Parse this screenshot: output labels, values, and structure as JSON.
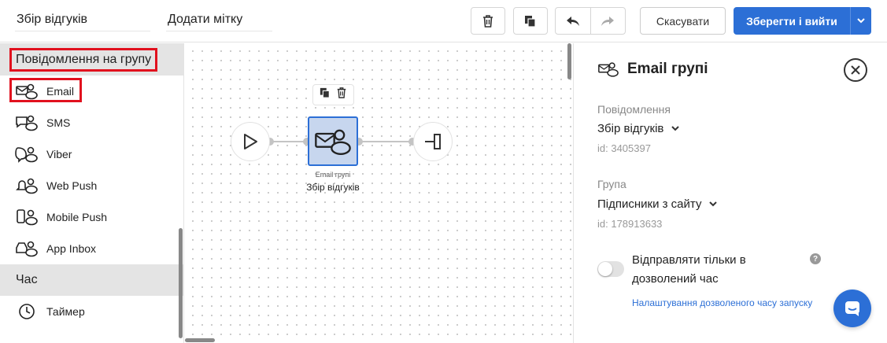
{
  "toolbar": {
    "campaign_name": "Збір відгуків",
    "add_tag": "Додати мітку",
    "cancel_label": "Скасувати",
    "save_label": "Зберегти і вийти",
    "icons": [
      "trash-icon",
      "copy-icon",
      "undo-icon",
      "redo-icon",
      "chevron-down-icon"
    ]
  },
  "sidebar": {
    "sections": [
      {
        "title": "Повідомлення на групу",
        "items": [
          {
            "label": "Email",
            "icon": "email-group-icon"
          },
          {
            "label": "SMS",
            "icon": "sms-group-icon"
          },
          {
            "label": "Viber",
            "icon": "viber-group-icon"
          },
          {
            "label": "Web Push",
            "icon": "webpush-group-icon"
          },
          {
            "label": "Mobile Push",
            "icon": "mobilepush-group-icon"
          },
          {
            "label": "App Inbox",
            "icon": "appinbox-group-icon"
          }
        ]
      },
      {
        "title": "Час",
        "items": [
          {
            "label": "Таймер",
            "icon": "timer-icon"
          }
        ]
      }
    ]
  },
  "canvas": {
    "node": {
      "type_label": "Email групі",
      "name": "Збір відгуків"
    }
  },
  "panel": {
    "title": "Email групі",
    "message_label": "Повідомлення",
    "message_value": "Збір відгуків",
    "message_id": "id: 3405397",
    "group_label": "Група",
    "group_value": "Підписники з сайту",
    "group_id": "id: 178913633",
    "toggle_text": "Відправляти тільки в дозволений час",
    "toggle_on": false,
    "help": "?",
    "link_text": "Налаштування дозволеного часу запуску"
  },
  "colors": {
    "accent": "#2c6fd6",
    "highlight_box": "#e1111e",
    "node_fill": "#c7d6ee"
  }
}
